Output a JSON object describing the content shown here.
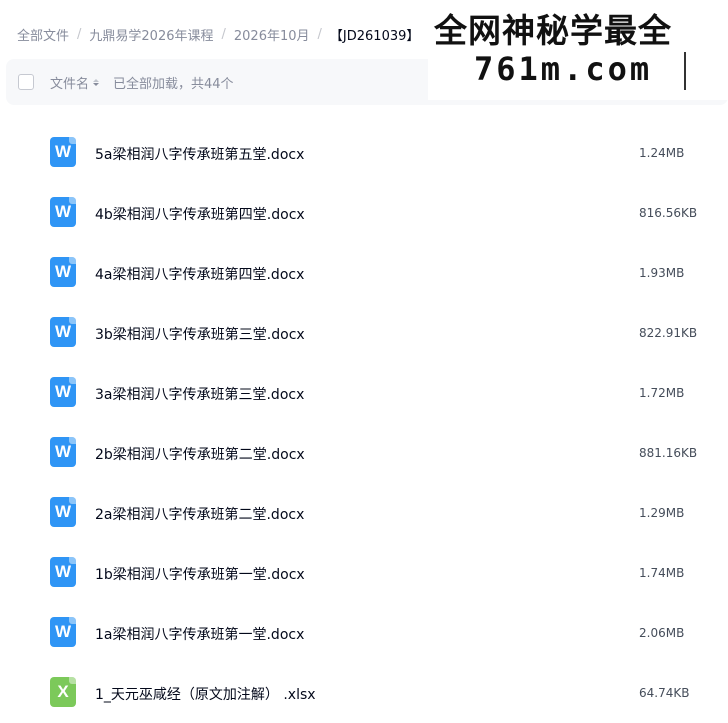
{
  "breadcrumb": [
    "全部文件",
    "九鼎易学2026年课程",
    "2026年10月",
    "【JD261039】"
  ],
  "header": {
    "name_column": "文件名",
    "load_status": "已全部加载，共44个"
  },
  "watermark": {
    "line1": "全网神秘学最全",
    "line2": "761m.com"
  },
  "icons": {
    "docx": "word-file-icon",
    "xlsx": "excel-file-icon"
  },
  "colors": {
    "word": "#2f95f5",
    "excel": "#7cc95a"
  },
  "files": [
    {
      "name": "5a梁相润八字传承班第五堂.docx",
      "size": "1.24MB",
      "type": "docx",
      "glyph": "W"
    },
    {
      "name": "4b梁相润八字传承班第四堂.docx",
      "size": "816.56KB",
      "type": "docx",
      "glyph": "W"
    },
    {
      "name": "4a梁相润八字传承班第四堂.docx",
      "size": "1.93MB",
      "type": "docx",
      "glyph": "W"
    },
    {
      "name": "3b梁相润八字传承班第三堂.docx",
      "size": "822.91KB",
      "type": "docx",
      "glyph": "W"
    },
    {
      "name": "3a梁相润八字传承班第三堂.docx",
      "size": "1.72MB",
      "type": "docx",
      "glyph": "W"
    },
    {
      "name": "2b梁相润八字传承班第二堂.docx",
      "size": "881.16KB",
      "type": "docx",
      "glyph": "W"
    },
    {
      "name": "2a梁相润八字传承班第二堂.docx",
      "size": "1.29MB",
      "type": "docx",
      "glyph": "W"
    },
    {
      "name": "1b梁相润八字传承班第一堂.docx",
      "size": "1.74MB",
      "type": "docx",
      "glyph": "W"
    },
    {
      "name": "1a梁相润八字传承班第一堂.docx",
      "size": "2.06MB",
      "type": "docx",
      "glyph": "W"
    },
    {
      "name": "1_天元巫咸经（原文加注解） .xlsx",
      "size": "64.74KB",
      "type": "xlsx",
      "glyph": "X"
    }
  ]
}
